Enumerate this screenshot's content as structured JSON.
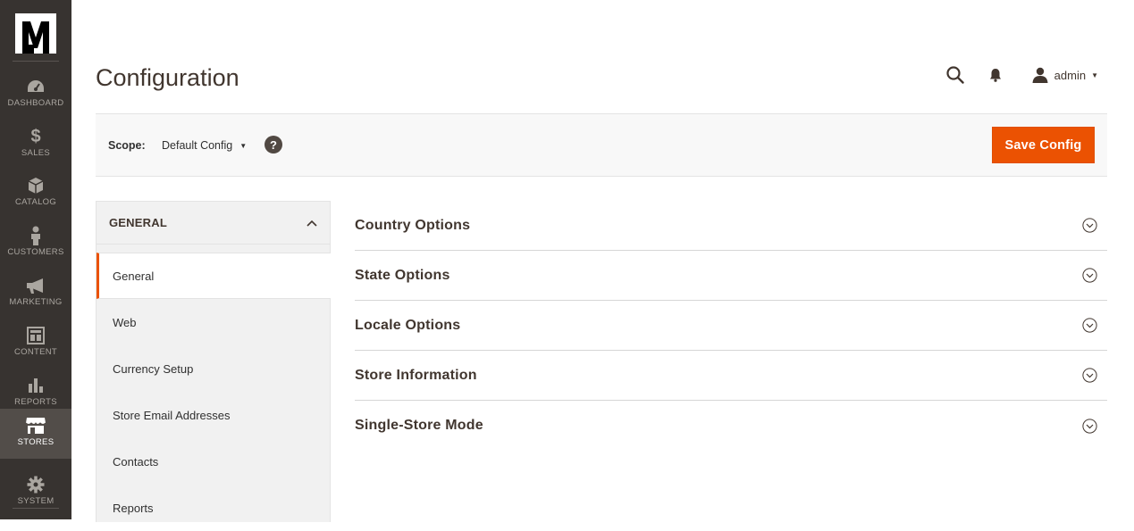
{
  "menu": {
    "logo": "magento-logo",
    "items": [
      {
        "label": "DASHBOARD",
        "icon": "dashboard-icon"
      },
      {
        "label": "SALES",
        "icon": "dollar-icon"
      },
      {
        "label": "CATALOG",
        "icon": "cube-icon"
      },
      {
        "label": "CUSTOMERS",
        "icon": "person-icon"
      },
      {
        "label": "MARKETING",
        "icon": "megaphone-icon"
      },
      {
        "label": "CONTENT",
        "icon": "layout-icon"
      },
      {
        "label": "REPORTS",
        "icon": "bar-chart-icon"
      },
      {
        "label": "STORES",
        "icon": "storefront-icon",
        "active": true
      },
      {
        "label": "SYSTEM",
        "icon": "gear-icon"
      }
    ]
  },
  "header": {
    "title": "Configuration",
    "user": "admin"
  },
  "scope": {
    "label": "Scope:",
    "value": "Default Config",
    "help": "?",
    "save_label": "Save Config"
  },
  "tabs": {
    "group_title": "GENERAL",
    "items": [
      {
        "label": "General",
        "active": true
      },
      {
        "label": "Web"
      },
      {
        "label": "Currency Setup"
      },
      {
        "label": "Store Email Addresses"
      },
      {
        "label": "Contacts"
      },
      {
        "label": "Reports"
      }
    ]
  },
  "sections": [
    {
      "title": "Country Options"
    },
    {
      "title": "State Options"
    },
    {
      "title": "Locale Options"
    },
    {
      "title": "Store Information"
    },
    {
      "title": "Single-Store Mode"
    }
  ],
  "colors": {
    "menu_bg": "#373330",
    "menu_active": "#524d49",
    "accent": "#eb5202",
    "title": "#41362f"
  }
}
